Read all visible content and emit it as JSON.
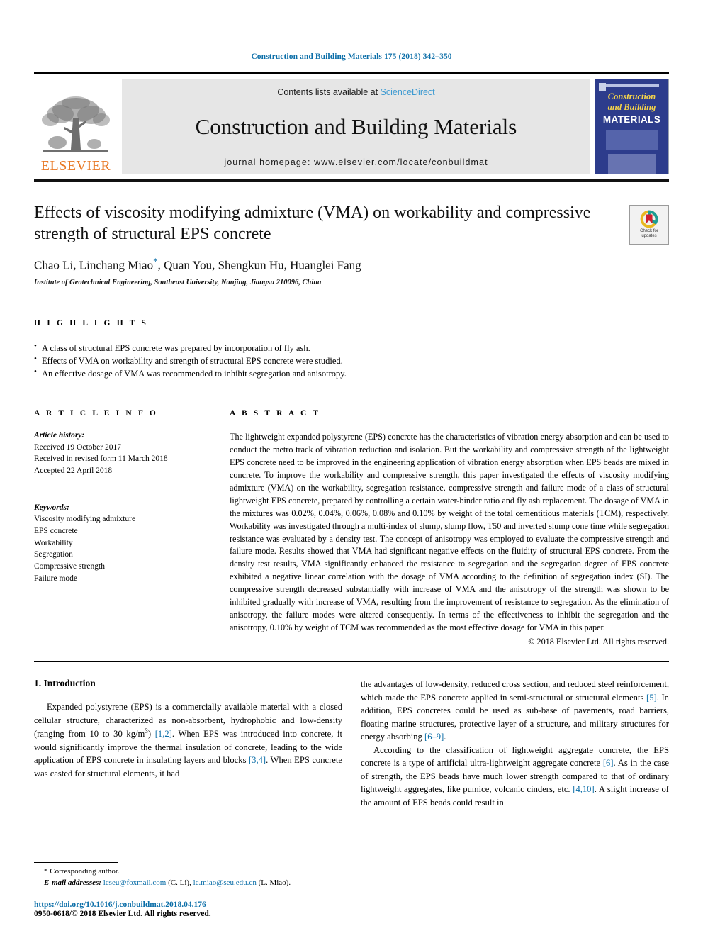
{
  "running_head": "Construction and Building Materials 175 (2018) 342–350",
  "masthead": {
    "publisher_logo_text": "ELSEVIER",
    "contents_prefix": "Contents lists available at ",
    "contents_link": "ScienceDirect",
    "journal_title": "Construction and Building Materials",
    "homepage": "journal homepage: www.elsevier.com/locate/conbuildmat",
    "cover": {
      "line1": "Construction",
      "line2": "and Building",
      "line3": "MATERIALS"
    }
  },
  "article": {
    "title": "Effects of viscosity modifying admixture (VMA) on workability and compressive strength of structural EPS concrete",
    "authors": "Chao Li, Linchang Miao",
    "authors_rest": ", Quan You, Shengkun Hu, Huanglei Fang",
    "corresponding_marker": "*",
    "affiliation": "Institute of Geotechnical Engineering, Southeast University, Nanjing, Jiangsu 210096, China",
    "crossmark_line1": "Check for",
    "crossmark_line2": "updates"
  },
  "highlights": {
    "heading": "H I G H L I G H T S",
    "items": [
      "A class of structural EPS concrete was prepared by incorporation of fly ash.",
      "Effects of VMA on workability and strength of structural EPS concrete were studied.",
      "An effective dosage of VMA was recommended to inhibit segregation and anisotropy."
    ]
  },
  "article_info": {
    "heading": "A R T I C L E   I N F O",
    "history_title": "Article history:",
    "history": [
      "Received 19 October 2017",
      "Received in revised form 11 March 2018",
      "Accepted 22 April 2018"
    ],
    "keywords_title": "Keywords:",
    "keywords": [
      "Viscosity modifying admixture",
      "EPS concrete",
      "Workability",
      "Segregation",
      "Compressive strength",
      "Failure mode"
    ]
  },
  "abstract": {
    "heading": "A B S T R A C T",
    "text": "The lightweight expanded polystyrene (EPS) concrete has the characteristics of vibration energy absorption and can be used to conduct the metro track of vibration reduction and isolation. But the workability and compressive strength of the lightweight EPS concrete need to be improved in the engineering application of vibration energy absorption when EPS beads are mixed in concrete. To improve the workability and compressive strength, this paper investigated the effects of viscosity modifying admixture (VMA) on the workability, segregation resistance, compressive strength and failure mode of a class of structural lightweight EPS concrete, prepared by controlling a certain water-binder ratio and fly ash replacement. The dosage of VMA in the mixtures was 0.02%, 0.04%, 0.06%, 0.08% and 0.10% by weight of the total cementitious materials (TCM), respectively. Workability was investigated through a multi-index of slump, slump flow, T50 and inverted slump cone time while segregation resistance was evaluated by a density test. The concept of anisotropy was employed to evaluate the compressive strength and failure mode. Results showed that VMA had significant negative effects on the fluidity of structural EPS concrete. From the density test results, VMA significantly enhanced the resistance to segregation and the segregation degree of EPS concrete exhibited a negative linear correlation with the dosage of VMA according to the definition of segregation index (SI). The compressive strength decreased substantially with increase of VMA and the anisotropy of the strength was shown to be inhibited gradually with increase of VMA, resulting from the improvement of resistance to segregation. As the elimination of anisotropy, the failure modes were altered consequently. In terms of the effectiveness to inhibit the segregation and the anisotropy, 0.10% by weight of TCM was recommended as the most effective dosage for VMA in this paper.",
    "copyright": "© 2018 Elsevier Ltd. All rights reserved."
  },
  "body": {
    "section_number_title": "1. Introduction",
    "left_paragraph_1_a": "Expanded polystyrene (EPS) is a commercially available material with a closed cellular structure, characterized as non-absorbent, hydrophobic and low-density (ranging from 10 to 30 kg/m",
    "left_paragraph_1_sup": "3",
    "left_paragraph_1_b": ") ",
    "left_ref_1": "[1,2]",
    "left_paragraph_1_c": ". When EPS was introduced into concrete, it would significantly improve the thermal insulation of concrete, leading to the wide application of EPS concrete in insulating layers and blocks ",
    "left_ref_2": "[3,4]",
    "left_paragraph_1_d": ". When EPS concrete was casted for structural elements, it had",
    "right_paragraph_1_a": "the advantages of low-density, reduced cross section, and reduced steel reinforcement, which made the EPS concrete applied in semi-structural or structural elements ",
    "right_ref_1": "[5]",
    "right_paragraph_1_b": ". In addition, EPS concretes could be used as sub-base of pavements, road barriers, floating marine structures, protective layer of a structure, and military structures for energy absorbing ",
    "right_ref_2": "[6–9]",
    "right_paragraph_1_c": ".",
    "right_paragraph_2_a": "According to the classification of lightweight aggregate concrete, the EPS concrete is a type of artificial ultra-lightweight aggregate concrete ",
    "right_ref_3": "[6]",
    "right_paragraph_2_b": ". As in the case of strength, the EPS beads have much lower strength compared to that of ordinary lightweight aggregates, like pumice, volcanic cinders, etc. ",
    "right_ref_4": "[4,10]",
    "right_paragraph_2_c": ". A slight increase of the amount of EPS beads could result in"
  },
  "footer": {
    "corresponding_marker": "*",
    "corresponding_label": "Corresponding author.",
    "email_label": "E-mail addresses:",
    "email_1": "lcseu@foxmail.com",
    "email_1_owner": "(C. Li),",
    "email_2": "lc.miao@seu.edu.cn",
    "email_2_owner": "(L. Miao).",
    "doi": "https://doi.org/10.1016/j.conbuildmat.2018.04.176",
    "issn_line": "0950-0618/© 2018 Elsevier Ltd. All rights reserved."
  },
  "colors": {
    "link_blue": "#0b6ea8",
    "science_direct_blue": "#3d9ad1",
    "elsevier_orange": "#E87722",
    "cover_navy": "#2d3c8c",
    "cover_yellow": "#f5d34a"
  }
}
